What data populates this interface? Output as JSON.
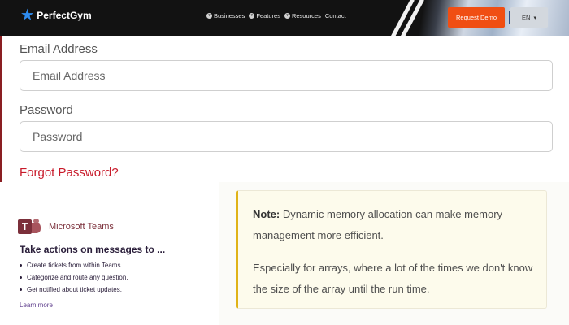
{
  "header": {
    "logo_text": "PerfectGym",
    "nav": [
      {
        "label": "Businesses"
      },
      {
        "label": "Features"
      },
      {
        "label": "Resources"
      },
      {
        "label": "Contact"
      }
    ],
    "demo_label": "Request Demo",
    "lang_label": "EN",
    "brand_colors": {
      "accent": "#f04e13",
      "logo": "#2e8cf0"
    }
  },
  "login": {
    "email_label": "Email Address",
    "email_placeholder": "Email Address",
    "password_label": "Password",
    "password_placeholder": "Password",
    "forgot_label": "Forgot Password?"
  },
  "teams": {
    "brand": "Microsoft Teams",
    "title": "Take actions on messages to ...",
    "items": [
      "Create tickets from within Teams.",
      "Categorize and route any question.",
      "Get notified about ticket updates."
    ],
    "learn_more": "Learn more"
  },
  "note": {
    "bold_label": "Note:",
    "line1": " Dynamic memory allocation can make memory management more efficient.",
    "line2": "Especially for arrays, where a lot of the times we don't know the size of the array until the run time."
  }
}
